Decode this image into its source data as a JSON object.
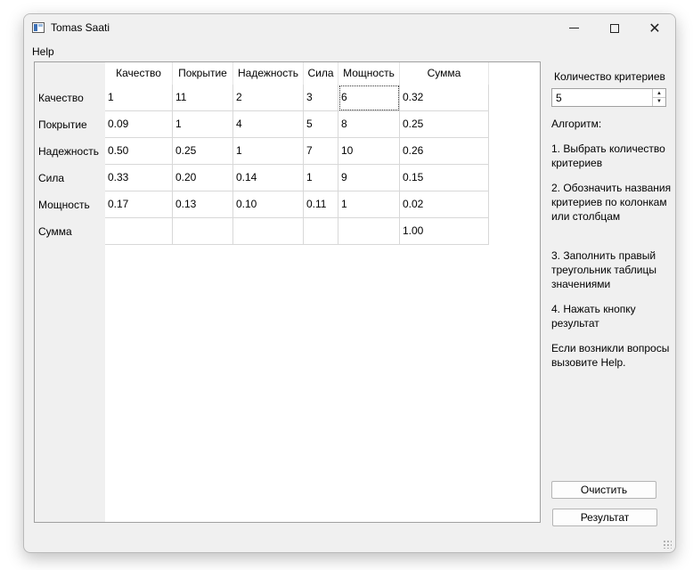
{
  "window": {
    "title": "Tomas Saati",
    "minimize_glyph": "minimize-icon",
    "maximize_glyph": "maximize-icon",
    "close_glyph": "✕"
  },
  "menu": {
    "help": "Help"
  },
  "table": {
    "columns": [
      "Качество",
      "Покрытие",
      "Надежность",
      "Сила",
      "Мощность",
      "Сумма"
    ],
    "rows": [
      {
        "label": "Качество",
        "cells": [
          "1",
          "11",
          "2",
          "3",
          "6",
          "0.32"
        ]
      },
      {
        "label": "Покрытие",
        "cells": [
          "0.09",
          "1",
          "4",
          "5",
          "8",
          "0.25"
        ]
      },
      {
        "label": "Надежность",
        "cells": [
          "0.50",
          "0.25",
          "1",
          "7",
          "10",
          "0.26"
        ]
      },
      {
        "label": "Сила",
        "cells": [
          "0.33",
          "0.20",
          "0.14",
          "1",
          "9",
          "0.15"
        ]
      },
      {
        "label": "Мощность",
        "cells": [
          "0.17",
          "0.13",
          "0.10",
          "0.11",
          "1",
          "0.02"
        ]
      },
      {
        "label": "Сумма",
        "cells": [
          "",
          "",
          "",
          "",
          "",
          "1.00"
        ]
      }
    ],
    "current_cell": "row 0, column 4"
  },
  "panel": {
    "count_label": "Количество критериев",
    "count_value": "5",
    "algo_title": "Алгоритм:",
    "steps": [
      "1. Выбрать количество критериев",
      "2. Обозначить названия критериев по колонкам или столбцам",
      "3. Заполнить правый треугольник таблицы значениями",
      "4. Нажать кнопку результат"
    ],
    "note": "Если возникли вопросы вызовите Help.",
    "clear_button": "Очистить",
    "result_button": "Результат"
  }
}
